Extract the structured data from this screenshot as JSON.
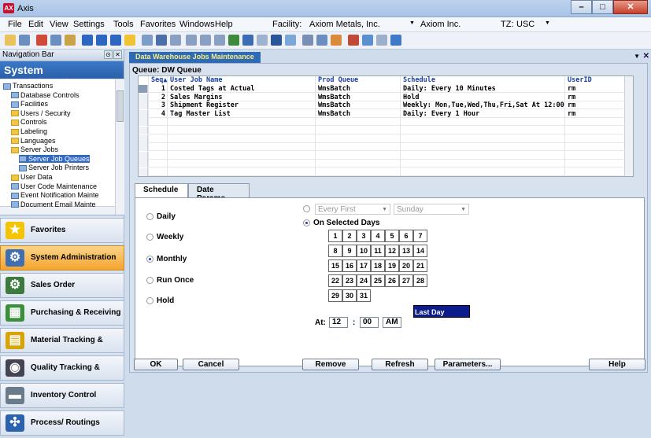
{
  "app": {
    "title": "Axis",
    "logo_text": "AX"
  },
  "window_buttons": {
    "minimize": "–",
    "maximize": "□",
    "close": "✕"
  },
  "menu": [
    "File",
    "Edit",
    "View",
    "Settings",
    "Tools",
    "Favorites",
    "Windows",
    "Help"
  ],
  "facility": {
    "label": "Facility:",
    "value": "Axiom Metals, Inc.",
    "company": "Axiom Inc."
  },
  "timezone": {
    "label": "TZ:",
    "value": "USC"
  },
  "nav": {
    "header": "Navigation Bar",
    "title": "System Administration",
    "tree": [
      {
        "label": "Transactions",
        "indent": 0,
        "kind": "node"
      },
      {
        "label": "Database Controls",
        "indent": 1,
        "kind": "node"
      },
      {
        "label": "Facilities",
        "indent": 1,
        "kind": "node"
      },
      {
        "label": "Users / Security",
        "indent": 1,
        "kind": "folder"
      },
      {
        "label": "Controls",
        "indent": 1,
        "kind": "folder"
      },
      {
        "label": "Labeling",
        "indent": 1,
        "kind": "folder"
      },
      {
        "label": "Languages",
        "indent": 1,
        "kind": "folder"
      },
      {
        "label": "Server Jobs",
        "indent": 1,
        "kind": "folder"
      },
      {
        "label": "Server Job Queues",
        "indent": 2,
        "kind": "node",
        "selected": true
      },
      {
        "label": "Server Job Printers",
        "indent": 2,
        "kind": "node"
      },
      {
        "label": "User Data",
        "indent": 1,
        "kind": "folder"
      },
      {
        "label": "User Code Maintenance",
        "indent": 1,
        "kind": "node"
      },
      {
        "label": "Event Notification Mainte",
        "indent": 1,
        "kind": "node"
      },
      {
        "label": "Document Email Mainte",
        "indent": 1,
        "kind": "node"
      }
    ],
    "sections": [
      {
        "label": "Favorites",
        "icon": "★",
        "color": "#f5c400"
      },
      {
        "label": "System Administration",
        "icon": "⚙",
        "color": "#3f6fb0",
        "active": true
      },
      {
        "label": "Sales Order Management",
        "icon": "⚙",
        "color": "#3d7a3d"
      },
      {
        "label": "Purchasing & Receiving",
        "icon": "▦",
        "color": "#3a8f3a"
      },
      {
        "label": "Material Tracking & Control",
        "icon": "▤",
        "color": "#d8a400"
      },
      {
        "label": "Quality Tracking & Control",
        "icon": "◉",
        "color": "#445"
      },
      {
        "label": "Inventory Control",
        "icon": "▬",
        "color": "#6a7b8c"
      },
      {
        "label": "Process/ Routings",
        "icon": "✣",
        "color": "#2b62b0"
      }
    ]
  },
  "doc_tab": "Data Warehouse Jobs Maintenance",
  "queue_label": "Queue: DW Queue",
  "grid": {
    "columns": [
      "Seq",
      "User Job Name",
      "Prod Queue",
      "Schedule",
      "UserID"
    ],
    "sort_glyph": "▲",
    "rows": [
      {
        "seq": "1",
        "name": "Costed Tags at Actual",
        "queue": "WmsBatch",
        "schedule": "Daily: Every 10 Minutes",
        "user": "rm"
      },
      {
        "seq": "2",
        "name": "Sales Margins",
        "queue": "WmsBatch",
        "schedule": "Hold",
        "user": "rm"
      },
      {
        "seq": "3",
        "name": "Shipment Register",
        "queue": "WmsBatch",
        "schedule": "Weekly: Mon,Tue,Wed,Thu,Fri,Sat At 12:00",
        "user": "rm"
      },
      {
        "seq": "4",
        "name": "Tag Master List",
        "queue": "WmsBatch",
        "schedule": "Daily: Every 1 Hour",
        "user": "rm"
      }
    ]
  },
  "tabs": [
    "Schedule",
    "Date Params"
  ],
  "schedule": {
    "frequencies": [
      "Daily",
      "Weekly",
      "Monthly",
      "Run Once",
      "Hold"
    ],
    "selected_frequency": "Monthly",
    "every_first": "Every First",
    "weekday": "Sunday",
    "on_selected_days": "On Selected Days",
    "days": [
      "1",
      "2",
      "3",
      "4",
      "5",
      "6",
      "7",
      "8",
      "9",
      "10",
      "11",
      "12",
      "13",
      "14",
      "15",
      "16",
      "17",
      "18",
      "19",
      "20",
      "21",
      "22",
      "23",
      "24",
      "25",
      "26",
      "27",
      "28",
      "29",
      "30",
      "31"
    ],
    "last_day": "Last Day",
    "at_label": "At:",
    "hour": "12",
    "minute": "00",
    "ampm": "AM",
    "colon": ":"
  },
  "buttons": {
    "ok": "OK",
    "cancel": "Cancel",
    "remove": "Remove",
    "refresh": "Refresh",
    "parameters": "Parameters...",
    "help": "Help"
  }
}
